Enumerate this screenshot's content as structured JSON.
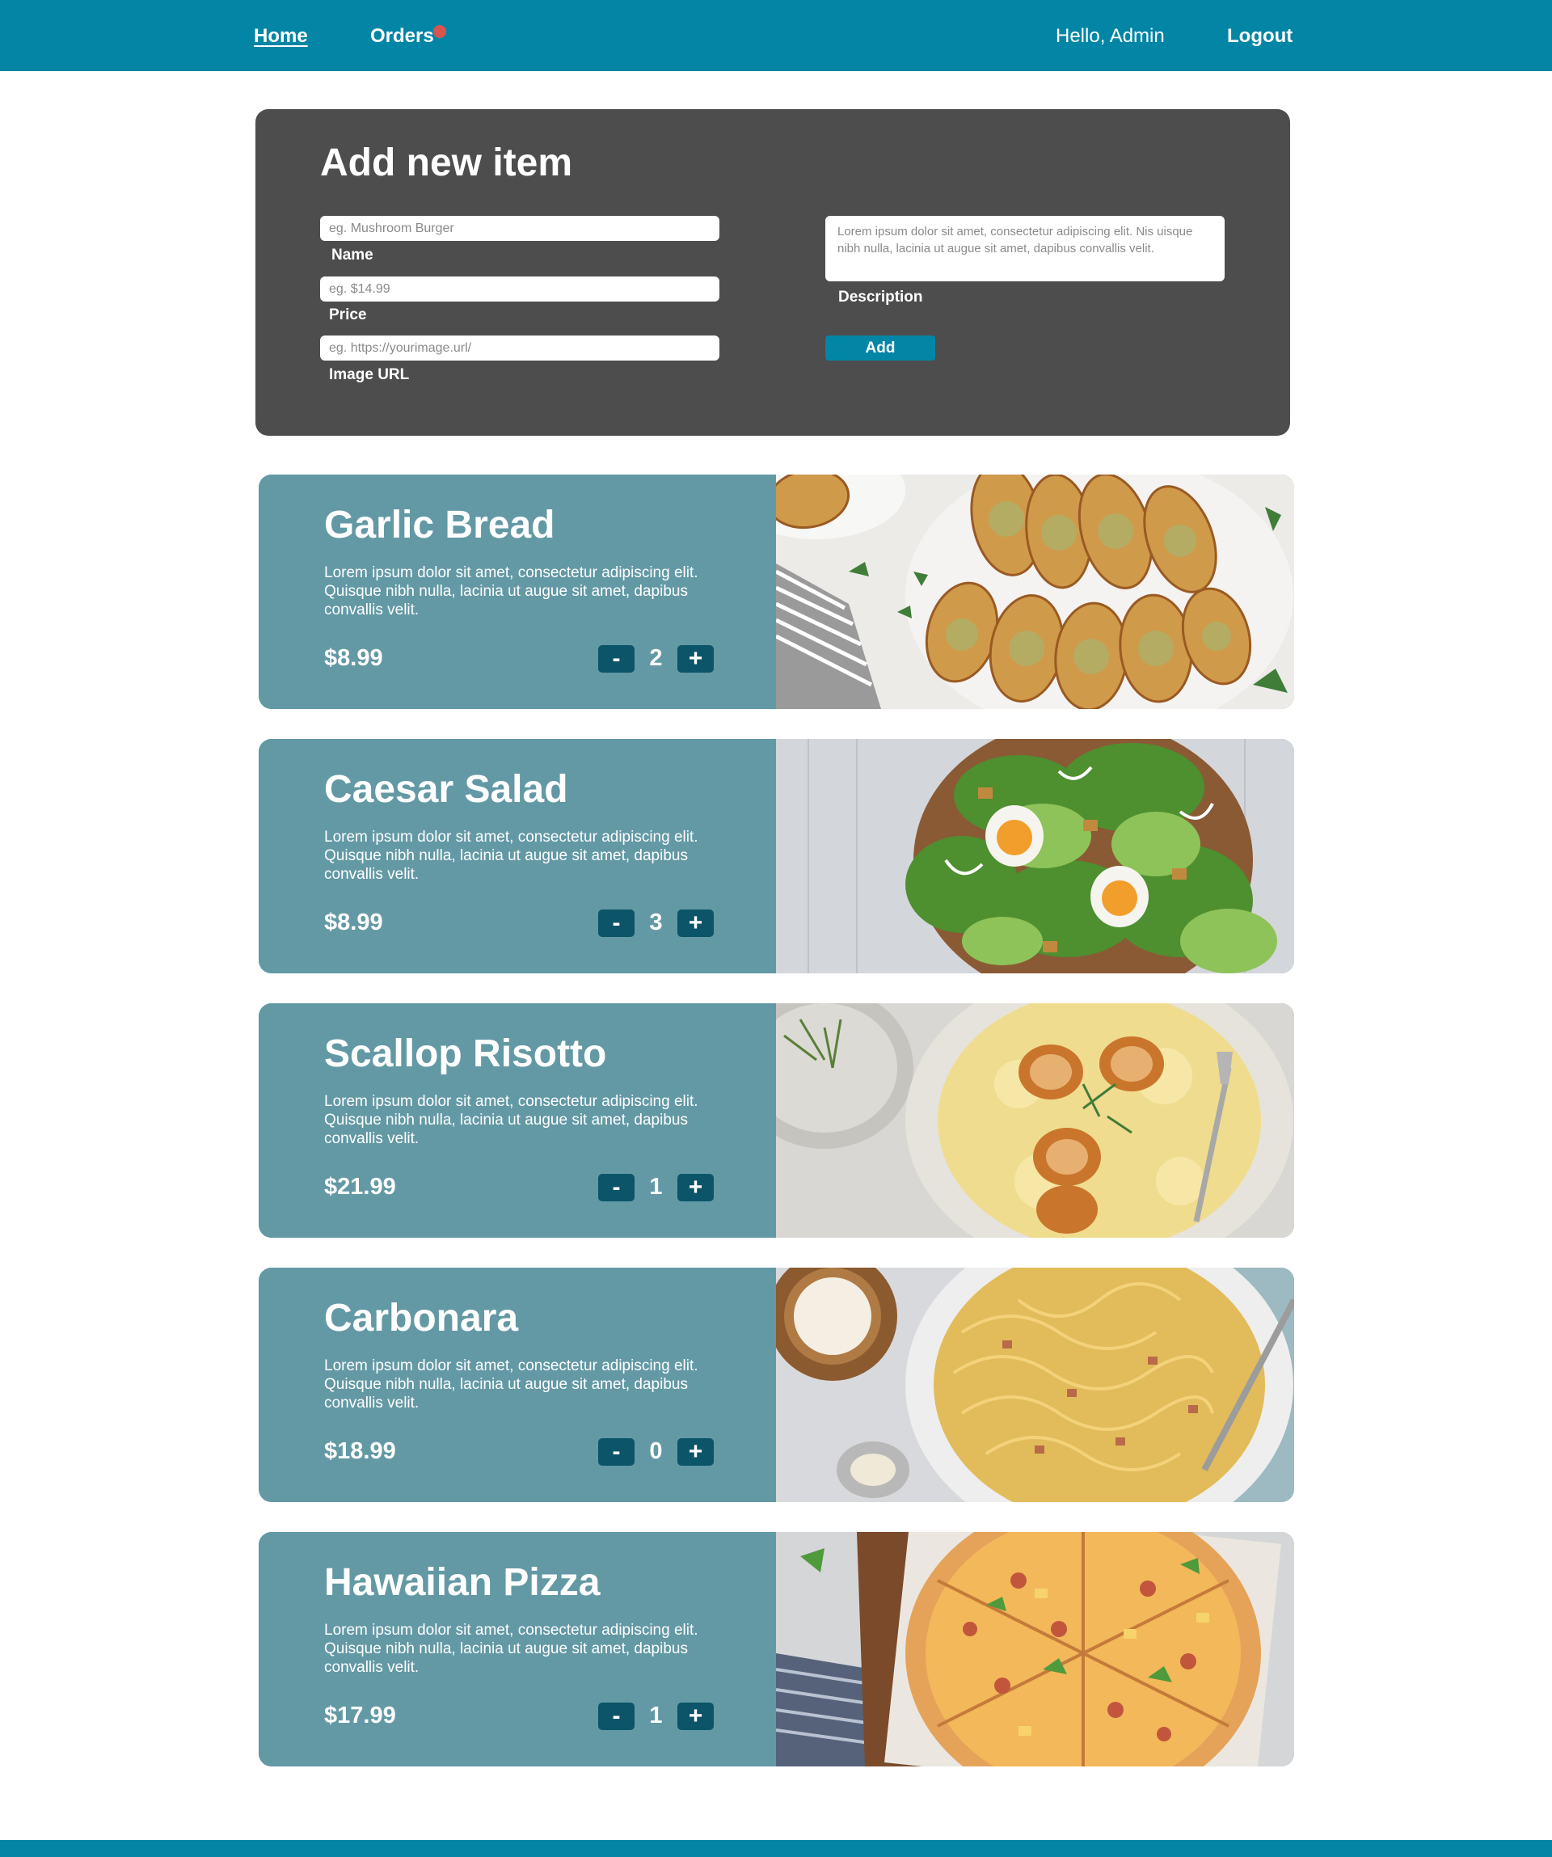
{
  "nav": {
    "home": "Home",
    "orders": "Orders",
    "greeting": "Hello, Admin",
    "logout": "Logout"
  },
  "add_item": {
    "title": "Add new item",
    "name_placeholder": "eg. Mushroom Burger",
    "name_label": "Name",
    "price_placeholder": "eg. $14.99",
    "price_label": "Price",
    "image_placeholder": "eg. https://yourimage.url/",
    "image_label": "Image URL",
    "description_placeholder": "Lorem ipsum dolor sit amet, consectetur adipiscing elit. Nis uisque nibh nulla, lacinia ut augue sit amet, dapibus convallis velit.",
    "description_label": "Description",
    "add_button": "Add"
  },
  "qty_controls": {
    "minus": "-",
    "plus": "+"
  },
  "menu_items": [
    {
      "name": "Garlic Bread",
      "description": "Lorem ipsum dolor sit amet, consectetur adipiscing elit. Quisque nibh nulla, lacinia ut augue sit amet, dapibus convallis velit.",
      "price": "$8.99",
      "quantity": "2"
    },
    {
      "name": "Caesar Salad",
      "description": "Lorem ipsum dolor sit amet, consectetur adipiscing elit. Quisque nibh nulla, lacinia ut augue sit amet, dapibus convallis velit.",
      "price": "$8.99",
      "quantity": "3"
    },
    {
      "name": "Scallop Risotto",
      "description": "Lorem ipsum dolor sit amet, consectetur adipiscing elit. Quisque nibh nulla, lacinia ut augue sit amet, dapibus convallis velit.",
      "price": "$21.99",
      "quantity": "1"
    },
    {
      "name": "Carbonara",
      "description": "Lorem ipsum dolor sit amet, consectetur adipiscing elit. Quisque nibh nulla, lacinia ut augue sit amet, dapibus convallis velit.",
      "price": "$18.99",
      "quantity": "0"
    },
    {
      "name": "Hawaiian Pizza",
      "description": "Lorem ipsum dolor sit amet, consectetur adipiscing elit. Quisque nibh nulla, lacinia ut augue sit amet, dapibus convallis velit.",
      "price": "$17.99",
      "quantity": "1"
    }
  ],
  "colors": {
    "nav_bg": "#0386a6",
    "panel_bg": "#4d4d4d",
    "card_bg": "#6399a5",
    "qty_button_bg": "#0c5468",
    "notification_dot": "#d9544f"
  }
}
